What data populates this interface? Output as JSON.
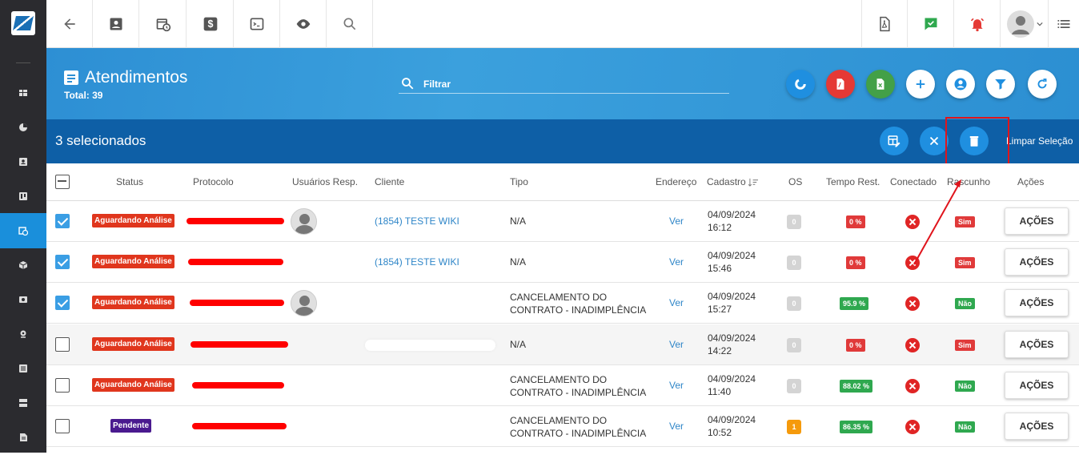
{
  "colors": {
    "sidebar_bg": "#2b2b2f",
    "sidebar_active": "#1a8fdb",
    "header_bg": "#3ba0dd",
    "selection_bar_bg": "#0e5fa6",
    "status_aguardando": "#e0361d",
    "status_pendente": "#4a1a8f",
    "tempo_red": "#e03a3a",
    "tempo_green": "#2fa84f",
    "rascunho_sim": "#e03a3a",
    "rascunho_nao": "#2fa84f",
    "os_grey": "#d4d4d4",
    "os_orange": "#f59a0c",
    "annotation_red": "#e0141c"
  },
  "sidebar": {
    "items": [
      {
        "icon": "dashboard-icon"
      },
      {
        "icon": "pie-chart-icon"
      },
      {
        "icon": "contact-card-icon"
      },
      {
        "icon": "kanban-icon"
      },
      {
        "icon": "calendar-clock-icon",
        "active": true
      },
      {
        "icon": "box-icon"
      },
      {
        "icon": "money-icon"
      },
      {
        "icon": "map-pin-icon"
      },
      {
        "icon": "list-icon"
      },
      {
        "icon": "server-icon"
      },
      {
        "icon": "document-icon"
      }
    ]
  },
  "topbar": {
    "left_icons": [
      "back-arrow-icon",
      "contact-card-icon",
      "calendar-clock-icon",
      "dollar-icon",
      "terminal-icon",
      "eye-icon",
      "search-icon"
    ],
    "right_icons": [
      "pdf-file-icon",
      "chat-check-icon",
      "alarm-bell-icon",
      "user-avatar-icon",
      "menu-list-icon"
    ]
  },
  "header": {
    "title": "Atendimentos",
    "total": "Total: 39",
    "filter_placeholder": "Filtrar",
    "action_buttons": [
      {
        "icon": "chart-donut-icon",
        "color": "#1f8fe0"
      },
      {
        "icon": "pdf-icon",
        "color": "#e53935"
      },
      {
        "icon": "excel-icon",
        "color": "#43a047"
      },
      {
        "icon": "plus-icon",
        "color": "#1f8fe0"
      },
      {
        "icon": "user-icon",
        "color": "#1f8fe0"
      },
      {
        "icon": "filter-icon",
        "color": "#1f8fe0"
      },
      {
        "icon": "refresh-icon",
        "color": "#1f8fe0"
      }
    ]
  },
  "selection": {
    "text": "3 selecionados",
    "clear_label": "Limpar Seleção",
    "buttons": [
      "edit-table-icon",
      "close-icon",
      "trash-icon"
    ]
  },
  "table": {
    "columns": [
      "Status",
      "Protocolo",
      "Usuários Resp.",
      "Cliente",
      "Tipo",
      "Endereço",
      "Cadastro",
      "OS",
      "Tempo Rest.",
      "Conectado",
      "Rascunho",
      "Ações"
    ],
    "sort_icon": "sort-desc-icon",
    "rows": [
      {
        "checked": true,
        "status": "Aguardando Análise",
        "status_color": "#e0361d",
        "avatar": true,
        "cliente": "(1854) TESTE WIKI",
        "tipo": [
          "N/A"
        ],
        "endereco": "Ver",
        "cadastro": [
          "04/09/2024",
          "16:12"
        ],
        "os": "0",
        "os_color": "#d4d4d4",
        "tempo": "0 %",
        "tempo_color": "#e03a3a",
        "rascunho": "Sim",
        "rascunho_color": "#e03a3a",
        "acoes": "AÇÕES"
      },
      {
        "checked": true,
        "status": "Aguardando Análise",
        "status_color": "#e0361d",
        "avatar": false,
        "cliente": "(1854) TESTE WIKI",
        "tipo": [
          "N/A"
        ],
        "endereco": "Ver",
        "cadastro": [
          "04/09/2024",
          "15:46"
        ],
        "os": "0",
        "os_color": "#d4d4d4",
        "tempo": "0 %",
        "tempo_color": "#e03a3a",
        "rascunho": "Sim",
        "rascunho_color": "#e03a3a",
        "acoes": "AÇÕES"
      },
      {
        "checked": true,
        "status": "Aguardando Análise",
        "status_color": "#e0361d",
        "avatar": true,
        "cliente": "",
        "tipo": [
          "CANCELAMENTO DO",
          "CONTRATO - INADIMPLÊNCIA"
        ],
        "endereco": "Ver",
        "cadastro": [
          "04/09/2024",
          "15:27"
        ],
        "os": "0",
        "os_color": "#d4d4d4",
        "tempo": "95.9 %",
        "tempo_color": "#2fa84f",
        "rascunho": "Não",
        "rascunho_color": "#2fa84f",
        "acoes": "AÇÕES"
      },
      {
        "checked": false,
        "status": "Aguardando Análise",
        "status_color": "#e0361d",
        "avatar": false,
        "cliente": "",
        "tipo": [
          "N/A"
        ],
        "endereco": "Ver",
        "cadastro": [
          "04/09/2024",
          "14:22"
        ],
        "os": "0",
        "os_color": "#d4d4d4",
        "tempo": "0 %",
        "tempo_color": "#e03a3a",
        "rascunho": "Sim",
        "rascunho_color": "#e03a3a",
        "acoes": "AÇÕES"
      },
      {
        "checked": false,
        "status": "Aguardando Análise",
        "status_color": "#e0361d",
        "avatar": false,
        "cliente": "",
        "tipo": [
          "CANCELAMENTO DO",
          "CONTRATO - INADIMPLÊNCIA"
        ],
        "endereco": "Ver",
        "cadastro": [
          "04/09/2024",
          "11:40"
        ],
        "os": "0",
        "os_color": "#d4d4d4",
        "tempo": "88.02 %",
        "tempo_color": "#2fa84f",
        "rascunho": "Não",
        "rascunho_color": "#2fa84f",
        "acoes": "AÇÕES"
      },
      {
        "checked": false,
        "status": "Pendente",
        "status_color": "#4a1a8f",
        "avatar": false,
        "cliente": "",
        "tipo": [
          "CANCELAMENTO DO",
          "CONTRATO - INADIMPLÊNCIA"
        ],
        "endereco": "Ver",
        "cadastro": [
          "04/09/2024",
          "10:52"
        ],
        "os": "1",
        "os_color": "#f59a0c",
        "tempo": "86.35 %",
        "tempo_color": "#2fa84f",
        "rascunho": "Não",
        "rascunho_color": "#2fa84f",
        "acoes": "AÇÕES"
      }
    ]
  }
}
